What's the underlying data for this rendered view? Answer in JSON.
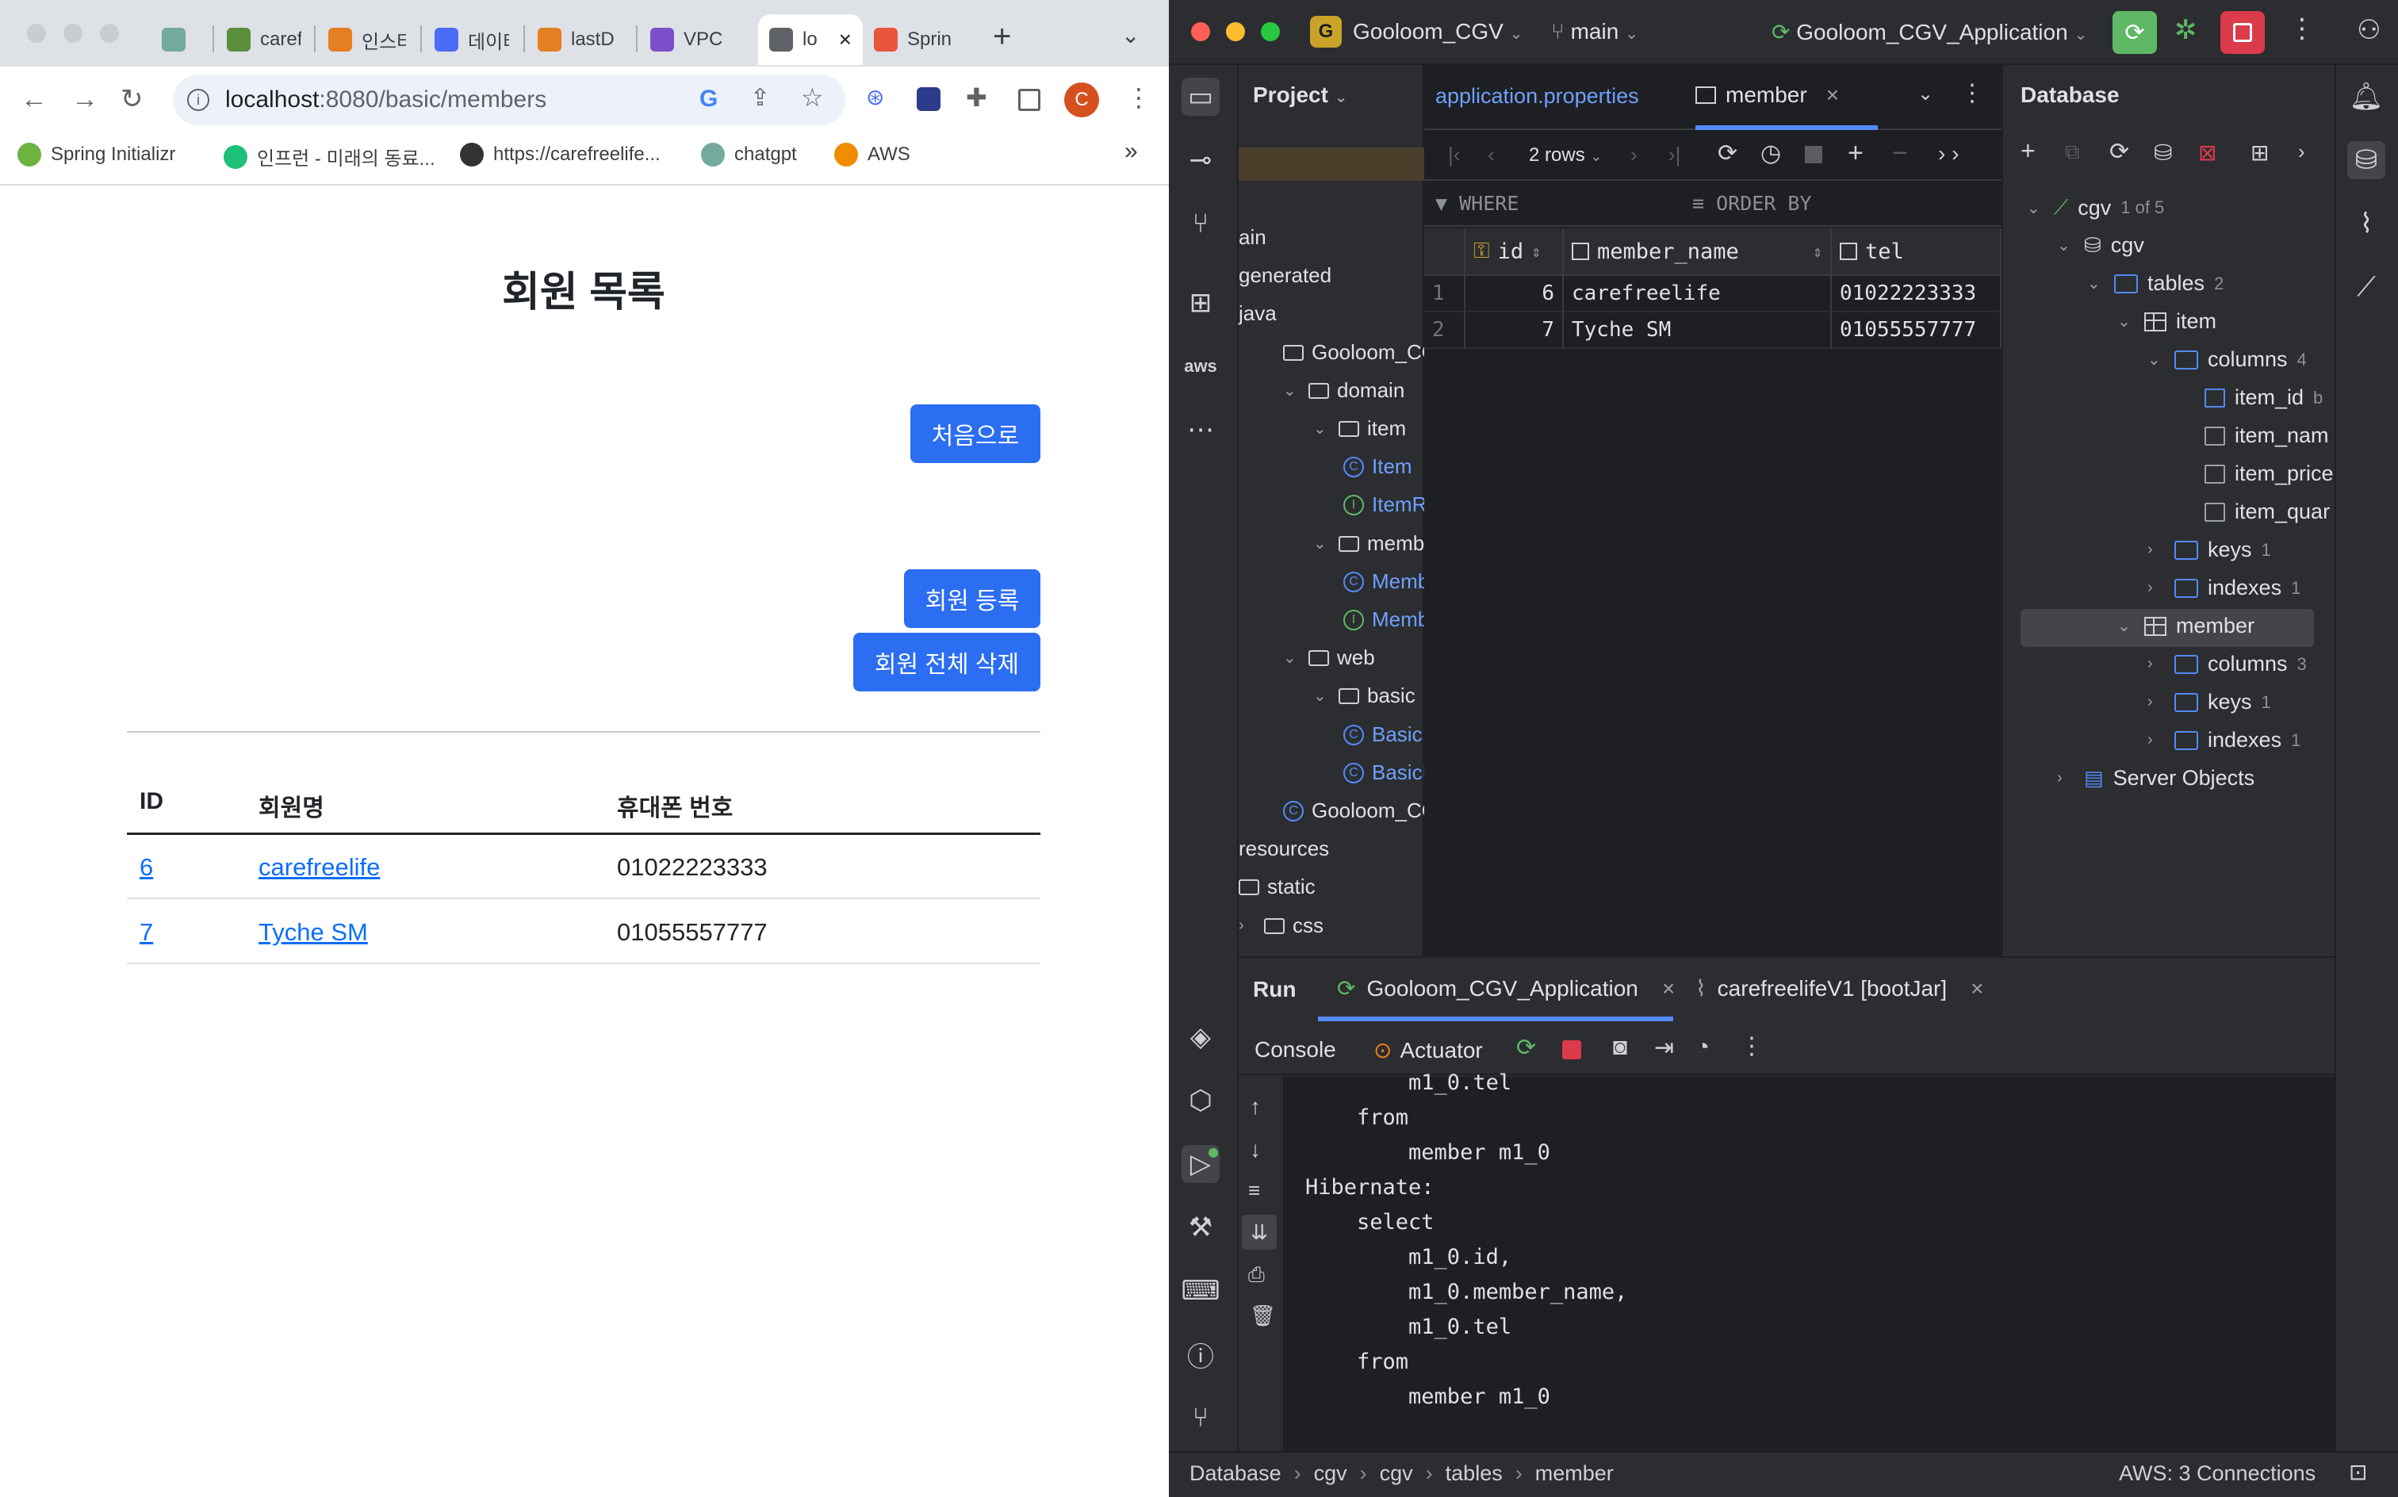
{
  "browser": {
    "tabs": [
      {
        "label": "",
        "favicon_color": "#74aa9c"
      },
      {
        "label": "caref",
        "favicon_color": "#5a8f3d"
      },
      {
        "label": "인스타",
        "favicon_color": "#e67e22"
      },
      {
        "label": "데이터",
        "favicon_color": "#4a6cf7"
      },
      {
        "label": "lastD",
        "favicon_color": "#e67e22"
      },
      {
        "label": "VPC",
        "favicon_color": "#7b4fc9"
      },
      {
        "label": "lo",
        "favicon_color": "#5f6368"
      },
      {
        "label": "Sprin",
        "favicon_color": "#e8553d"
      }
    ],
    "new_tab": "+",
    "tab_menu": "⌄",
    "url_host": "localhost",
    "url_rest": ":8080/basic/members",
    "profile_initial": "C",
    "bookmarks": [
      {
        "label": "Spring Initializr",
        "color": "#6db33f"
      },
      {
        "label": "인프런 - 미래의 동료...",
        "color": "#1dc078"
      },
      {
        "label": "https://carefreelife...",
        "color": "#333333"
      },
      {
        "label": "chatgpt",
        "color": "#74aa9c"
      },
      {
        "label": "AWS",
        "color": "#f08c00"
      }
    ],
    "bookmarks_more": "»"
  },
  "page": {
    "title": "회원 목록",
    "home_button": "처음으로",
    "register_button": "회원 등록",
    "delete_all_button": "회원 전체 삭제",
    "table": {
      "headers": [
        "ID",
        "회원명",
        "휴대폰 번호"
      ],
      "rows": [
        {
          "id": "6",
          "name": "carefreelife",
          "tel": "01022223333"
        },
        {
          "id": "7",
          "name": "Tyche SM",
          "tel": "01055557777"
        }
      ]
    }
  },
  "ide": {
    "project_badge": "G",
    "project_name": "Gooloom_CGV",
    "branch": "main",
    "run_config": "Gooloom_CGV_Application",
    "project_panel_title": "Project",
    "project_tree": [
      {
        "label": "ain",
        "indent": 0,
        "type": "text"
      },
      {
        "label": "generated",
        "indent": 0,
        "type": "text"
      },
      {
        "label": "java",
        "indent": 0,
        "type": "text"
      },
      {
        "label": "Gooloom_CGV_",
        "indent": 1,
        "type": "pkg"
      },
      {
        "label": "domain",
        "indent": 1,
        "type": "pkg",
        "chev": "⌄"
      },
      {
        "label": "item",
        "indent": 2,
        "type": "pkg",
        "chev": "⌄"
      },
      {
        "label": "Item",
        "indent": 3,
        "type": "class"
      },
      {
        "label": "ItemRe",
        "indent": 3,
        "type": "iface"
      },
      {
        "label": "member",
        "indent": 2,
        "type": "pkg",
        "chev": "⌄"
      },
      {
        "label": "Memb",
        "indent": 3,
        "type": "class"
      },
      {
        "label": "Memb",
        "indent": 3,
        "type": "iface"
      },
      {
        "label": "web",
        "indent": 1,
        "type": "pkg",
        "chev": "⌄"
      },
      {
        "label": "basic",
        "indent": 2,
        "type": "pkg",
        "chev": "⌄"
      },
      {
        "label": "BasicIt",
        "indent": 3,
        "type": "class"
      },
      {
        "label": "BasicM",
        "indent": 3,
        "type": "class"
      },
      {
        "label": "Gooloom_CG",
        "indent": 1,
        "type": "class-white"
      },
      {
        "label": "resources",
        "indent": 0,
        "type": "text"
      },
      {
        "label": "static",
        "indent": 0,
        "type": "fold"
      },
      {
        "label": "css",
        "indent": 0,
        "type": "fold",
        "chev": "›"
      }
    ],
    "editor_tabs": [
      {
        "label": "application.properties"
      },
      {
        "label": "member",
        "close": "×"
      }
    ],
    "rows_label": "2 rows",
    "where_label": "WHERE",
    "orderby_label": "ORDER BY",
    "grid_columns": [
      "id",
      "member_name",
      "tel"
    ],
    "grid_rows": [
      {
        "n": "1",
        "id": "6",
        "member_name": "carefreelife",
        "tel": "01022223333"
      },
      {
        "n": "2",
        "id": "7",
        "member_name": "Tyche SM",
        "tel": "01055557777"
      }
    ],
    "db_panel_title": "Database",
    "db_tree": [
      {
        "label": "cgv",
        "count": "1 of 5",
        "indent": 0,
        "icon": "conn",
        "chev": "⌄"
      },
      {
        "label": "cgv",
        "count": "",
        "indent": 1,
        "icon": "schema",
        "chev": "⌄"
      },
      {
        "label": "tables",
        "count": "2",
        "indent": 2,
        "icon": "fold",
        "chev": "⌄"
      },
      {
        "label": "item",
        "count": "",
        "indent": 3,
        "icon": "tbl",
        "chev": "⌄"
      },
      {
        "label": "columns",
        "count": "4",
        "indent": 4,
        "icon": "fold",
        "chev": "⌄"
      },
      {
        "label": "item_id",
        "count": "b",
        "indent": 5,
        "icon": "key"
      },
      {
        "label": "item_nam",
        "count": "",
        "indent": 5,
        "icon": "col"
      },
      {
        "label": "item_price",
        "count": "",
        "indent": 5,
        "icon": "col"
      },
      {
        "label": "item_quar",
        "count": "",
        "indent": 5,
        "icon": "col"
      },
      {
        "label": "keys",
        "count": "1",
        "indent": 4,
        "icon": "fold",
        "chev": "›"
      },
      {
        "label": "indexes",
        "count": "1",
        "indent": 4,
        "icon": "fold",
        "chev": "›"
      },
      {
        "label": "member",
        "count": "",
        "indent": 3,
        "icon": "tbl",
        "chev": "⌄",
        "selected": true
      },
      {
        "label": "columns",
        "count": "3",
        "indent": 4,
        "icon": "fold",
        "chev": "›"
      },
      {
        "label": "keys",
        "count": "1",
        "indent": 4,
        "icon": "fold",
        "chev": "›"
      },
      {
        "label": "indexes",
        "count": "1",
        "indent": 4,
        "icon": "fold",
        "chev": "›"
      },
      {
        "label": "Server Objects",
        "count": "",
        "indent": 1,
        "icon": "server",
        "chev": "›"
      }
    ],
    "run_label": "Run",
    "run_tabs": [
      {
        "label": "Gooloom_CGV_Application",
        "close": "×"
      },
      {
        "label": "carefreelifeV1 [bootJar]",
        "close": "×"
      }
    ],
    "console_tab": "Console",
    "actuator_tab": "Actuator",
    "console_lines": [
      "        m1_0.tel",
      "    from",
      "        member m1_0",
      "Hibernate:",
      "    select",
      "        m1_0.id,",
      "        m1_0.member_name,",
      "        m1_0.tel",
      "    from",
      "        member m1_0"
    ],
    "breadcrumb": [
      "Database",
      "cgv",
      "cgv",
      "tables",
      "member"
    ],
    "aws_status": "AWS: 3 Connections"
  }
}
